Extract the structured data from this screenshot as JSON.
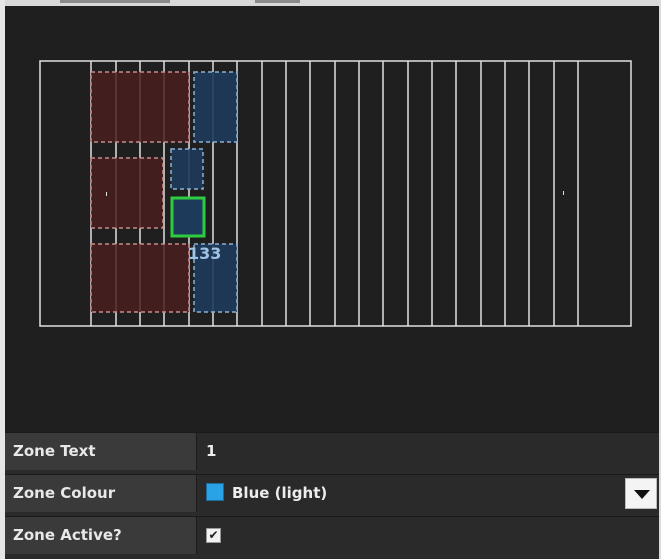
{
  "properties": {
    "zone_text_label": "Zone Text",
    "zone_text_value": "1",
    "zone_colour_label": "Zone Colour",
    "zone_colour_value": "Blue (light)",
    "zone_active_label": "Zone Active?",
    "zone_active_checked": true,
    "checkmark_glyph": "✔"
  },
  "pitch": {
    "overlap_label": "133",
    "colors": {
      "background": "#1f1f1f",
      "lines": "#e0e0e0",
      "red_zone_fill": "#4a1e1e",
      "red_zone_border": "#c98a8a",
      "blue_zone_fill": "#1d3a5a",
      "blue_zone_border": "#8ab2d6",
      "selected_border": "#2ecc40"
    }
  },
  "icons": {
    "dropdown": "chevron-down-icon",
    "checkbox": "checkbox-checked-icon",
    "swatch": "color-swatch-icon"
  }
}
